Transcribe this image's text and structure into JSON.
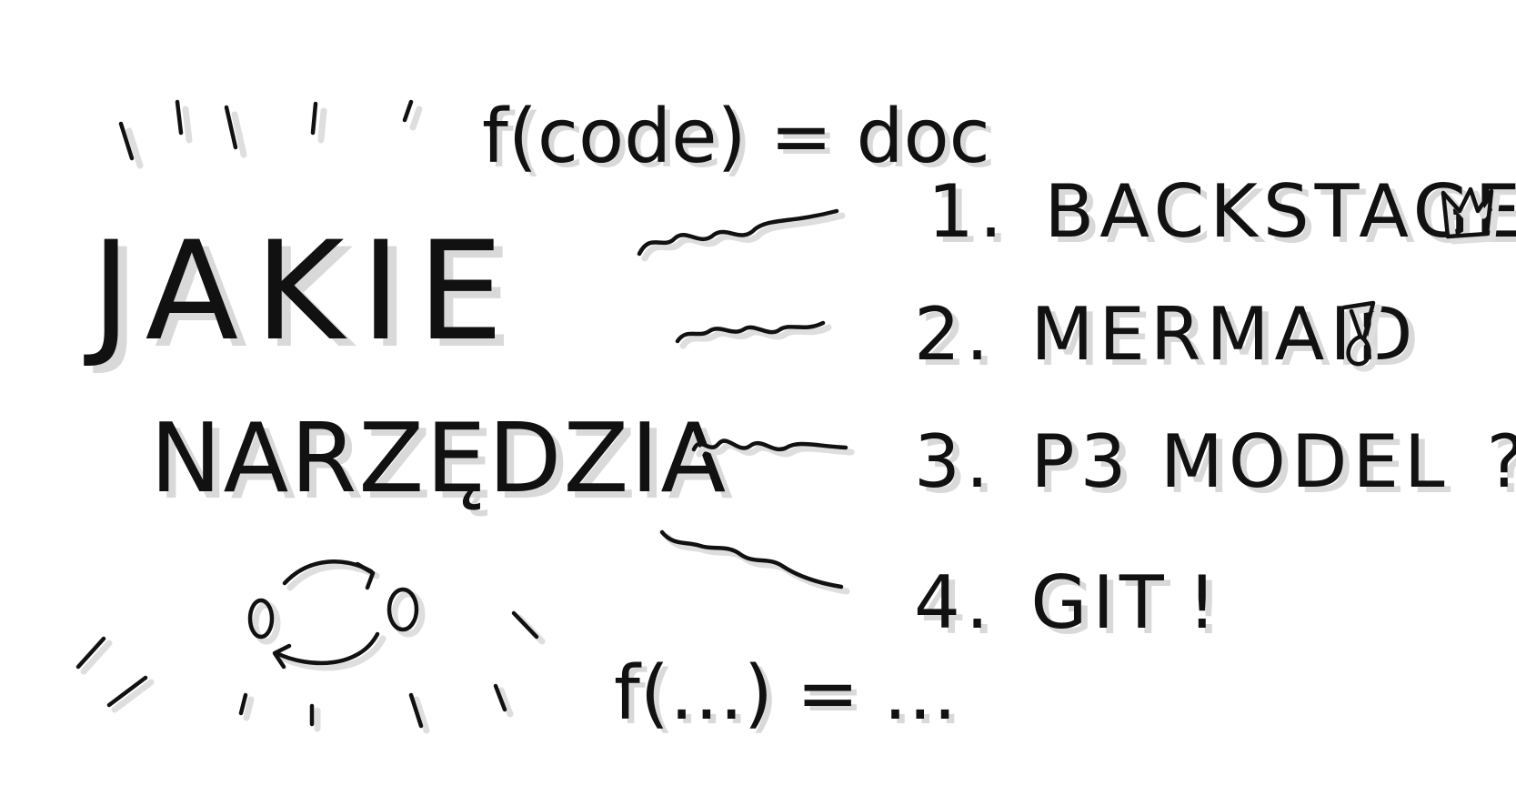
{
  "title": {
    "line1": "JAKIE",
    "line2": "NARZĘDZIA"
  },
  "formulas": {
    "top": "f(code) = doc",
    "bottom": "f(…) = …"
  },
  "list": [
    {
      "number": "1.",
      "label": "BACKSTAGE",
      "icon": "crown-icon"
    },
    {
      "number": "2.",
      "label": "MERMAID",
      "icon": "mermaid-tail-icon"
    },
    {
      "number": "3.",
      "label": "P3  MODEL",
      "suffix": "?!"
    },
    {
      "number": "4.",
      "label": "GIT",
      "suffix": "!"
    }
  ],
  "colors": {
    "ink": "#111111",
    "shadow": "#d9d9d9",
    "background": "#ffffff"
  }
}
